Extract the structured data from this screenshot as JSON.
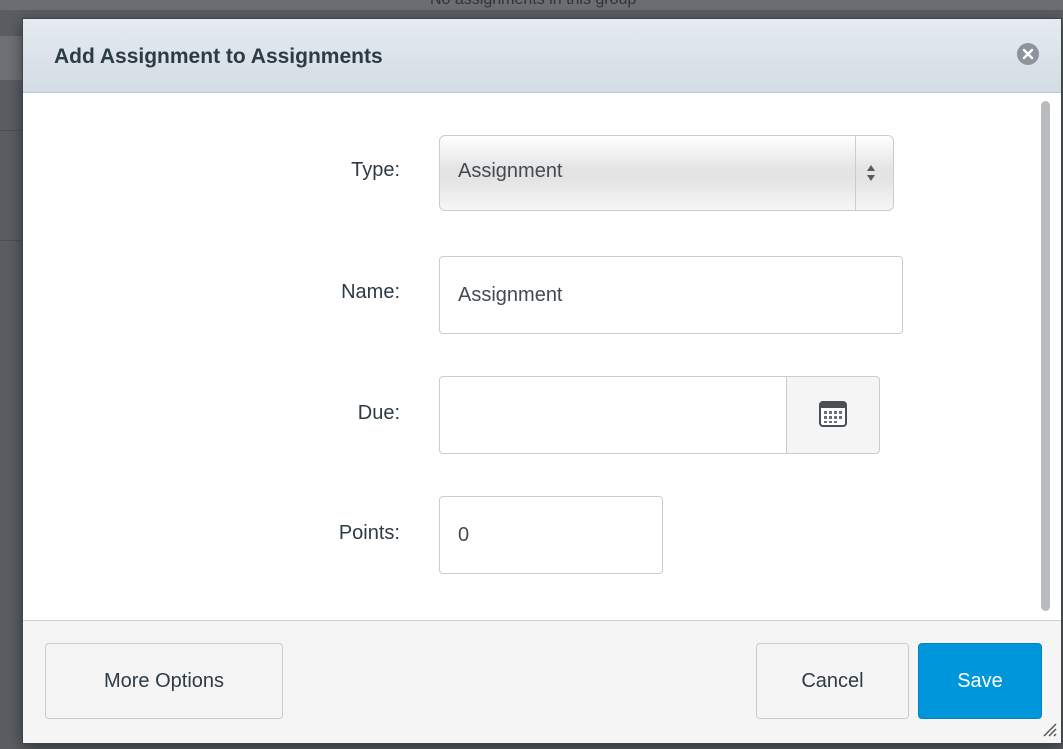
{
  "backdrop": {
    "top_text": "No assignments in this group"
  },
  "dialog": {
    "title": "Add Assignment to Assignments",
    "close_icon": "close-circle-icon"
  },
  "form": {
    "type": {
      "label": "Type:",
      "value": "Assignment",
      "icon": "select-arrows-icon"
    },
    "name": {
      "label": "Name:",
      "value": "Assignment"
    },
    "due": {
      "label": "Due:",
      "value": "",
      "icon": "calendar-icon"
    },
    "points": {
      "label": "Points:",
      "value": "0"
    }
  },
  "footer": {
    "more_options_label": "More Options",
    "cancel_label": "Cancel",
    "save_label": "Save"
  },
  "colors": {
    "primary": "#0096db",
    "title_text": "#2d3b45",
    "titlebar_bg": "#dde4ea"
  }
}
